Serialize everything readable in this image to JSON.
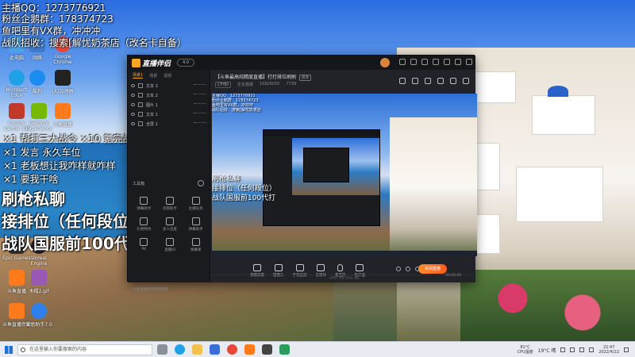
{
  "overlay": {
    "line1": "主播QQ：1273776921",
    "line2": "粉丝企鹅群：178374723",
    "line3": "鱼吧里有VX群，冲冲冲",
    "line4": "战队招收：搜索[解忧奶茶店（改名卡自备）",
    "cmd1": "×1 帮打三大战令 ×10 氪完战令",
    "cmd2": "×1 发言 永久车位",
    "cmd3": "×1 老板想让我咋样就咋样",
    "cmd4": "×1 要我干啥",
    "big1": "刷枪私聊",
    "big2": "接排位（任何段位）",
    "big3": "战队国服前100代打"
  },
  "desktop_icons": [
    {
      "label": "此电脑"
    },
    {
      "label": "网络"
    },
    {
      "label": "Google Chrome"
    },
    {
      "label": "Microsoft Edge"
    },
    {
      "label": "酷狗"
    },
    {
      "label": "UU加速器"
    },
    {
      "label": "Control Center 3.0"
    },
    {
      "label": "GeForce Experience"
    },
    {
      "label": "斗鱼直播"
    },
    {
      "label": "Epic Games"
    },
    {
      "label": "Unreal Engine"
    },
    {
      "label": "斗鱼直播"
    },
    {
      "label": "木帽2.gif"
    },
    {
      "label": "斗鱼直播伴侣"
    },
    {
      "label": "爱思助手7.0"
    }
  ],
  "window": {
    "app_name": "直播伴侣",
    "version": "4.0",
    "left_tabs": [
      "场景1",
      "场景",
      "视频"
    ],
    "layers": [
      {
        "name": "文本 3"
      },
      {
        "name": "文本 2"
      },
      {
        "name": "图片 1"
      },
      {
        "name": "文本 1"
      },
      {
        "name": "全屏 1"
      }
    ],
    "tool_header": "工具箱",
    "tools": [
      {
        "label": "弹幕助手"
      },
      {
        "label": "房管助手"
      },
      {
        "label": "主播任务"
      },
      {
        "label": "礼物特效"
      },
      {
        "label": "多人连麦"
      },
      {
        "label": "弹幕助手"
      },
      {
        "label": "PK"
      },
      {
        "label": "直播间"
      },
      {
        "label": "弹幕库"
      }
    ],
    "left_footer": "斗鱼直播伴侣使用教程",
    "room_title": "【斗鱼最高纯精度直播】打打排位刷刷",
    "edit_label": "修改",
    "room_meta": {
      "category": "CFHD",
      "tag": "生化救援",
      "viewers": "10626055",
      "likes": "7739"
    },
    "preview_texts": {
      "qq": "主播QQ：1273776921",
      "fans": "粉丝企鹅群：178374723",
      "vx": "鱼吧里有VX群，冲冲冲",
      "team": "战队招收：搜索[解忧奶茶店",
      "big1": "刷枪私聊",
      "big2": "接排位（任何段位）",
      "big3": "战队国服前100代打"
    },
    "controls": [
      {
        "label": "弹幕屏幕"
      },
      {
        "label": "摄像头"
      },
      {
        "label": "手机投屏"
      },
      {
        "label": "多媒体"
      },
      {
        "label": "麦克风"
      },
      {
        "label": "扬声器"
      }
    ],
    "start_live": "关闭直播",
    "timer": "00:00:00",
    "footer": "CPU: 0%   FPS: 60"
  },
  "taskbar": {
    "search_placeholder": "在这里输入你要搜索的内容",
    "cpu_temp": "81°C",
    "cpu_label": "CPU温度",
    "weather": "19°C 晴",
    "time": "22:47",
    "date": "2022/4/22"
  },
  "colors": {
    "accent": "#f5a623",
    "live_button": "#ff6a22"
  }
}
